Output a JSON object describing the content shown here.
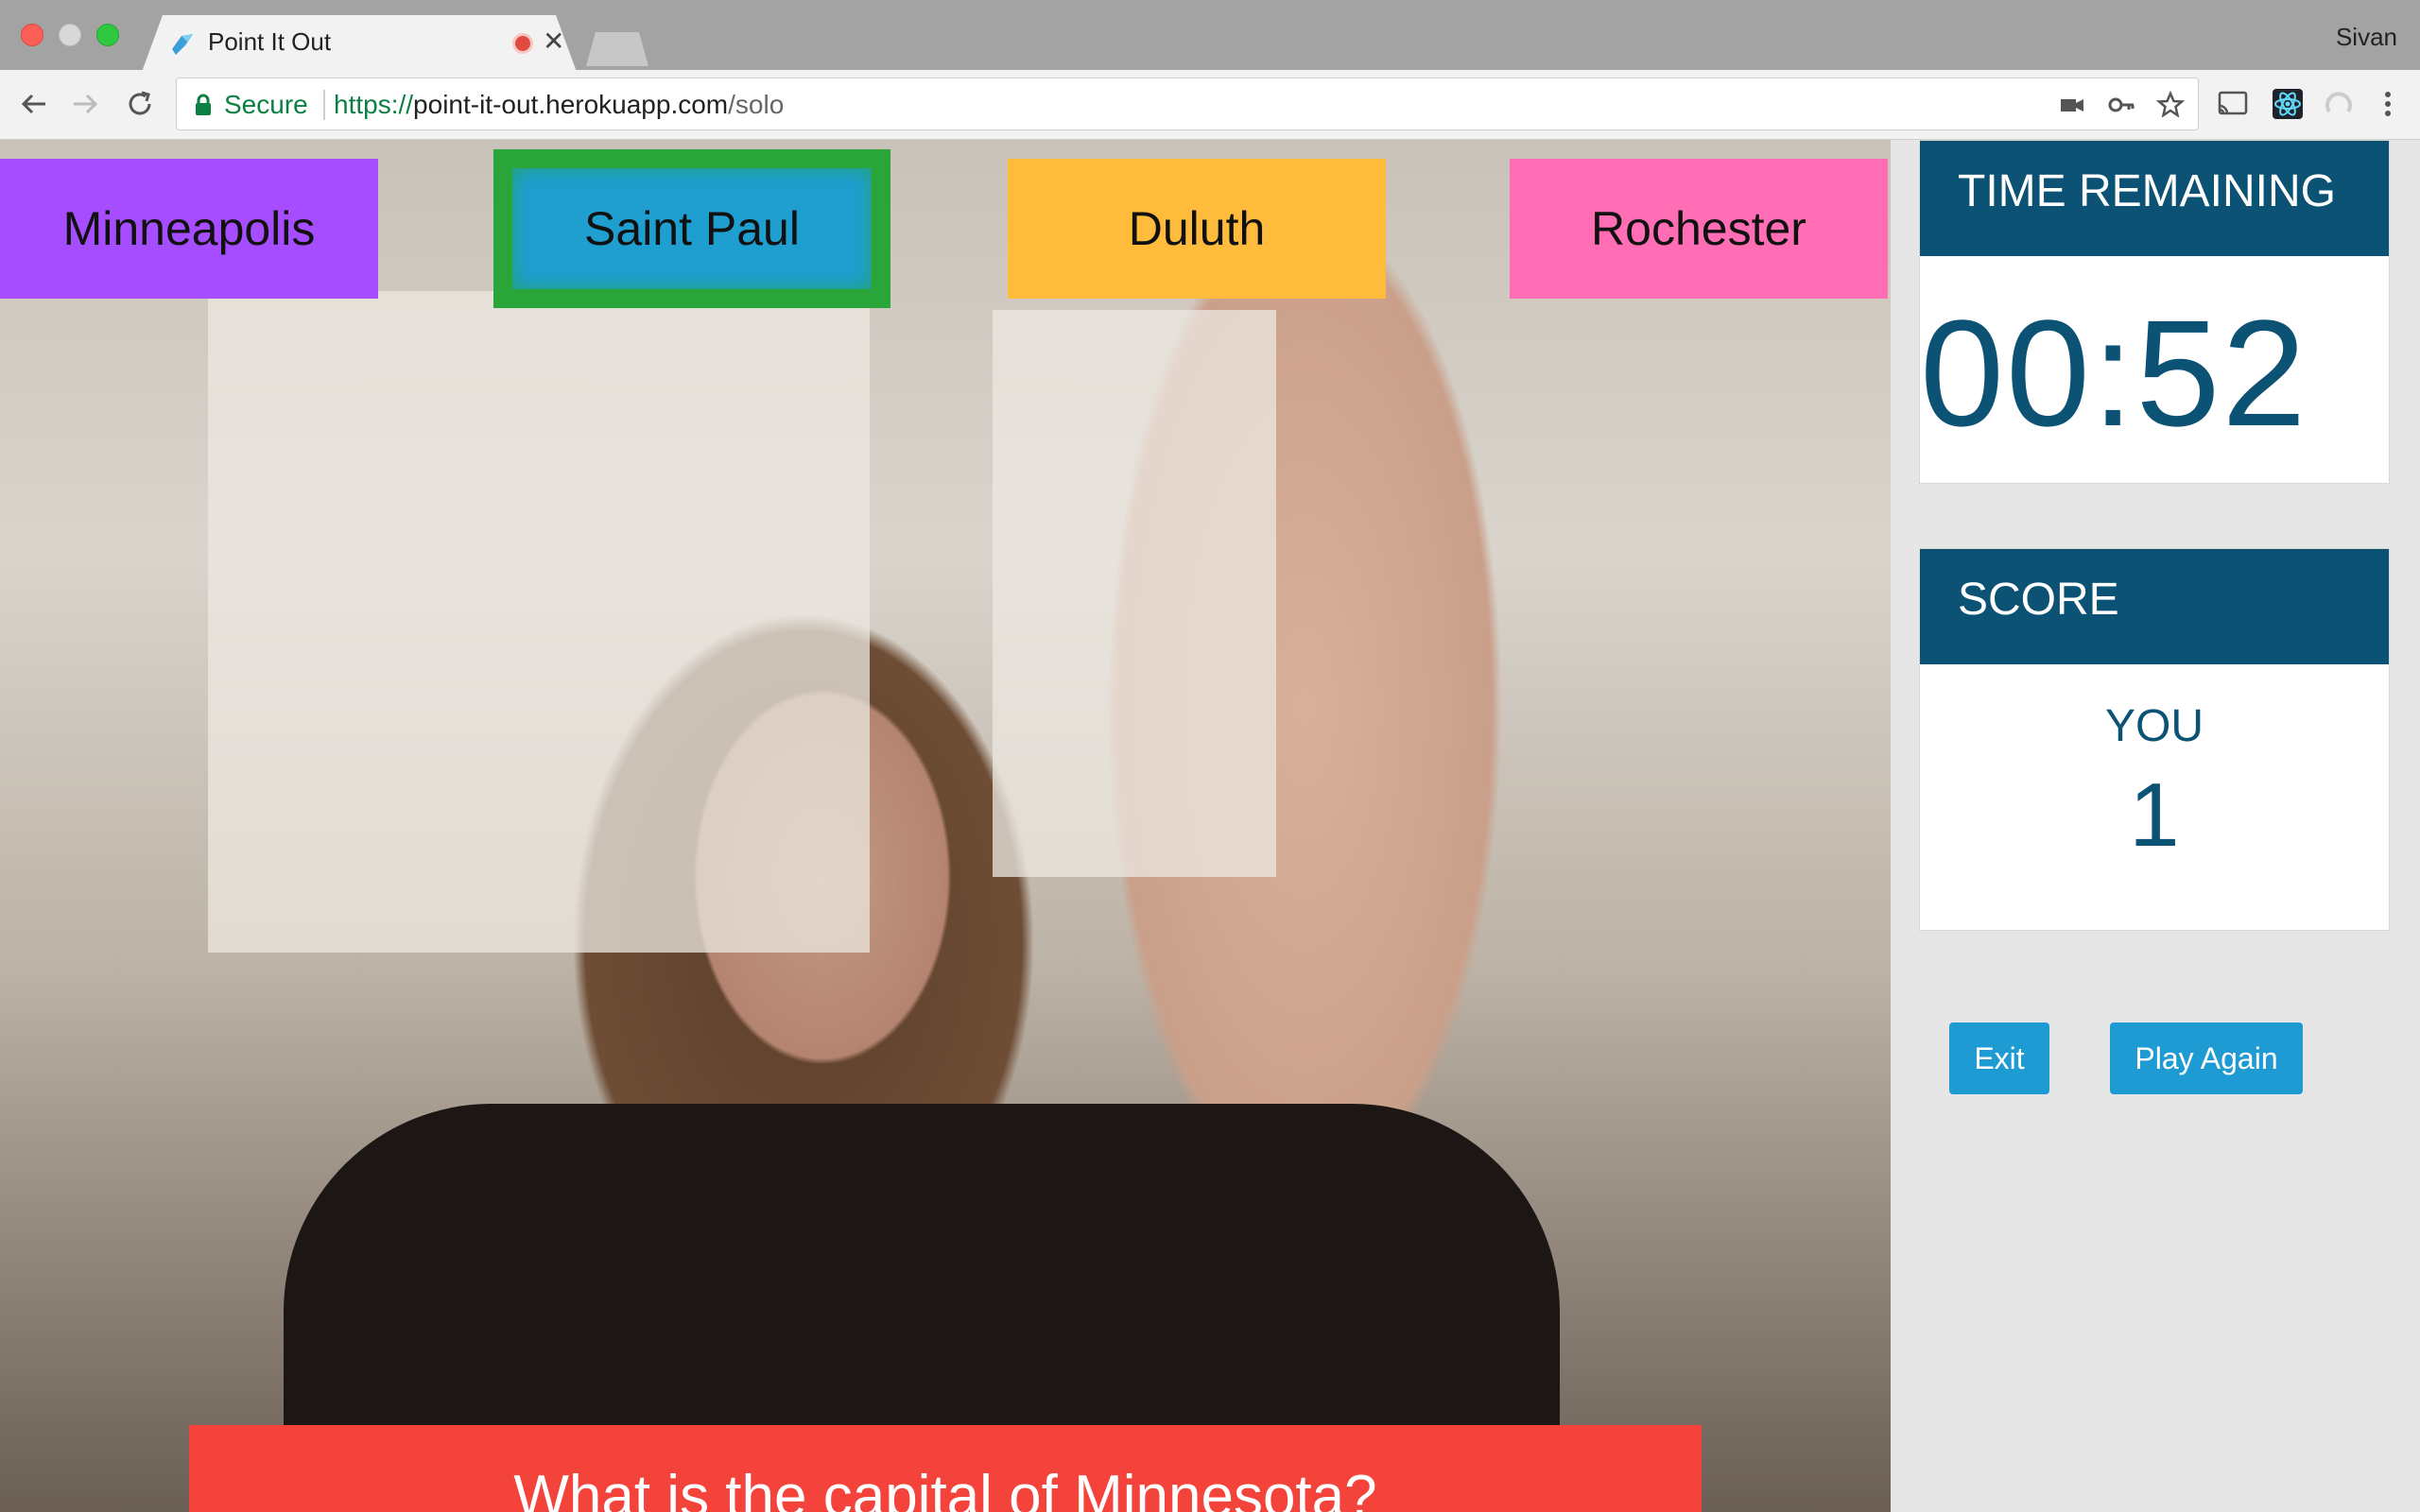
{
  "browser": {
    "tab_title": "Point It Out",
    "profile_name": "Sivan",
    "secure_label": "Secure",
    "url_scheme": "https://",
    "url_host": "point-it-out.herokuapp.com",
    "url_path": "/solo"
  },
  "game": {
    "answers": [
      "Minneapolis",
      "Saint Paul",
      "Duluth",
      "Rochester"
    ],
    "selected_answer": "Saint Paul",
    "question": "What is the capital of Minnesota?"
  },
  "timer": {
    "header": "TIME REMAINING",
    "value": "00:52"
  },
  "score": {
    "header": "SCORE",
    "player": "YOU",
    "value": "1"
  },
  "actions": {
    "exit_label": "Exit",
    "play_again_label": "Play Again"
  },
  "colors": {
    "accent": "#0c5274",
    "button": "#1e9bd2",
    "answer_1": "#a64dff",
    "answer_2": "#1e9fcf",
    "answer_2_selected_border": "#2aa53a",
    "answer_3": "#ffbb3b",
    "answer_4": "#ff6eb4",
    "question_bg": "#f4433b"
  }
}
